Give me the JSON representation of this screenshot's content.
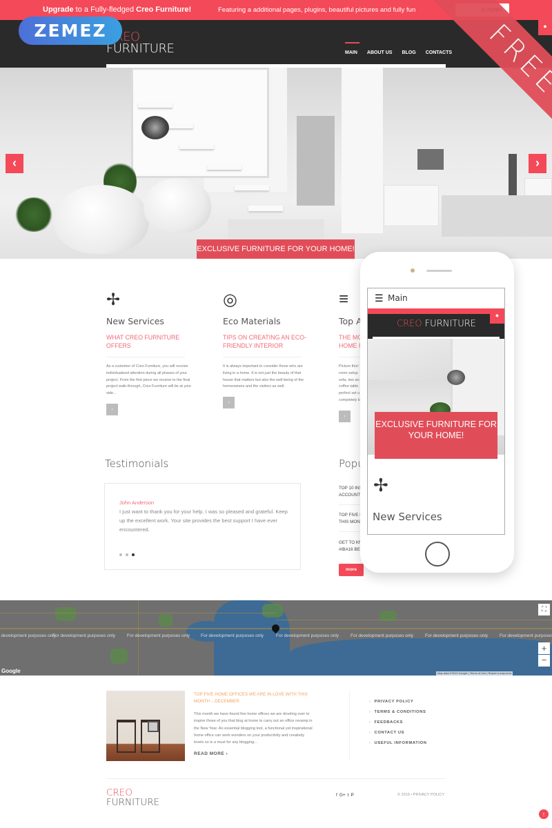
{
  "promo": {
    "lead_bold_1": "Upgrade",
    "lead_mid": " to a Fully-fledged ",
    "lead_bold_2": "Creo Furniture!",
    "features": "Featuring a additional pages, plugins, beautiful pictures and fully fun",
    "buy_label": "R NOW!"
  },
  "badge": {
    "zemez": "ZEMEZ",
    "free": "FREE"
  },
  "header": {
    "logo_line1": "CREO",
    "logo_line2": "FURNITURE",
    "nav": [
      {
        "label": "MAIN",
        "active": true
      },
      {
        "label": "ABOUT US",
        "active": false
      },
      {
        "label": "BLOG",
        "active": false
      },
      {
        "label": "CONTACTS",
        "active": false
      }
    ],
    "user_icon": "user-icon"
  },
  "hero": {
    "prev_icon": "‹",
    "next_icon": "›",
    "cta": "EXCLUSIVE FURNITURE FOR YOUR HOME!"
  },
  "features": [
    {
      "icon": "pinwheel-icon",
      "glyph": "✢",
      "title": "New Services",
      "subtitle": "WHAT CREO FURNITURE OFFERS",
      "text": "As a customer of Creo Furniture, you will receive individualized attention during all phases of your project. From the first piece we receive to the final project walk-through, Creo Furniture will be at your side...",
      "button": "›"
    },
    {
      "icon": "eco-target-icon",
      "glyph": "◎",
      "title": "Eco Materials",
      "subtitle": "TIPS ON CREATING AN ECO-FRIENDLY INTERIOR",
      "text": "It is always important to consider those who are living in a home. It is not just the beauty of that house that matters but also the well-being of the homeowners and the visitors as well.",
      "button": "›"
    },
    {
      "icon": "text-lines-icon",
      "glyph": "≡",
      "title": "Top A",
      "subtitle": "THE MO HOME I",
      "text": "Picture this! room setup sofa, two an coffee table perfect set u completely b",
      "button": "›"
    }
  ],
  "testimonials": {
    "title": "Testimonials",
    "name": "John Anderson",
    "quote": "I just want to thank you for your help. I was so pleased and grateful. Keep up the excellent work. Your site provides the best support I have ever encountered.",
    "dots": 3,
    "active_dot": 3
  },
  "popular": {
    "title": "Popu",
    "items": [
      {
        "line1": "TOP 10 INS",
        "line2": "ACCOUNTS"
      },
      {
        "line1": "TOP FIVE H",
        "line2": "THIS MON"
      },
      {
        "line1": "GET TO KN",
        "line2": "#IBA16 BES"
      }
    ],
    "more": "more"
  },
  "phone": {
    "menu_label": "Main",
    "logo_red": "CREO",
    "logo_white": " FURNITURE",
    "cta": "EXCLUSIVE FURNITURE FOR YOUR HOME!",
    "feature_title": "New Services"
  },
  "map": {
    "watermark": "For development purposes only",
    "google": "Google",
    "attribution": "Map data ©2019 Google | Terms of Use | Report a map error",
    "zoom_in": "+",
    "zoom_out": "−",
    "fullscreen": "⛶"
  },
  "blog": {
    "title": "TOP FIVE HOME OFFICES WE ARE IN LOVE WITH THIS MONTH – DECEMBER",
    "text": "This month we have found five home offices we are drooling over to inspire those of you that blog at home to carry out an office revamp in the New Year. An essential blogging tool, a functional yet inspirational home office can work wonders on your productivity and creativity levels so is a must for any blogging...",
    "read_more": "READ MORE ›"
  },
  "footer_links": [
    "PRIVACY POLICY",
    "TERMS & CONDITIONS",
    "FEEDBACKS",
    "CONTACT US",
    "USEFUL INFORMATION"
  ],
  "footer": {
    "logo_line1": "CREO",
    "logo_line2": "FURNITURE",
    "social": [
      "f",
      "G+",
      "t",
      "P"
    ],
    "copyright": "© 2019 • PRIVACY POLICY",
    "to_top": "↑"
  },
  "colors": {
    "accent": "#f44958",
    "accent_dark": "#e04d58",
    "header_bg": "#2a2a2a",
    "subtitle_pink": "#f06b77",
    "blog_orange": "#f5a25d"
  }
}
